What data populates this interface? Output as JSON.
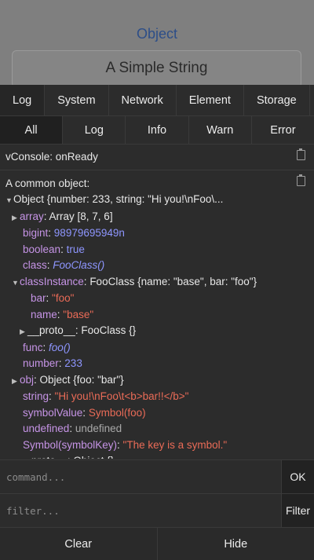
{
  "page": {
    "title": "Object",
    "input_value": "A Simple String"
  },
  "tabs": [
    "Log",
    "System",
    "Network",
    "Element",
    "Storage"
  ],
  "subtabs": [
    "All",
    "Log",
    "Info",
    "Warn",
    "Error"
  ],
  "logs": {
    "ready": "vConsole: onReady",
    "label": "A common object:",
    "object_summary": "Object {number: 233, string: \"Hi you!\\nFoo\\...",
    "lines": [
      {
        "k": "array",
        "v": "Array [8, 7, 6]"
      },
      {
        "k": "bigint",
        "v": "98979695949n"
      },
      {
        "k": "boolean",
        "v": "true"
      },
      {
        "k": "class",
        "v": "FooClass()"
      },
      {
        "k": "classInstance",
        "v": "FooClass {name: \"base\", bar: \"foo\"}"
      },
      {
        "k": "bar",
        "v": "\"foo\""
      },
      {
        "k": "name",
        "v": "\"base\""
      },
      {
        "k": "__proto__",
        "v": "FooClass {}"
      },
      {
        "k": "func",
        "v": "foo()"
      },
      {
        "k": "number",
        "v": "233"
      },
      {
        "k": "obj",
        "v": "Object {foo: \"bar\"}"
      },
      {
        "k": "string",
        "v": "\"Hi you!\\nFoo\\t<b>bar!!</b>\""
      },
      {
        "k": "symbolValue",
        "v": "Symbol(foo)"
      },
      {
        "k": "undefined",
        "v": "undefined"
      },
      {
        "k": "Symbol(symbolKey)",
        "v": "\"The key is a symbol.\""
      },
      {
        "k": "__proto__",
        "v": "Object {}"
      }
    ]
  },
  "command": {
    "placeholder": "command...",
    "button": "OK"
  },
  "filter": {
    "placeholder": "filter...",
    "button": "Filter"
  },
  "footer": {
    "clear": "Clear",
    "hide": "Hide"
  },
  "colors": {
    "key": "#c694e6",
    "number": "#8e96ff",
    "string": "#ea6b57",
    "panel": "#2c2c2c"
  }
}
